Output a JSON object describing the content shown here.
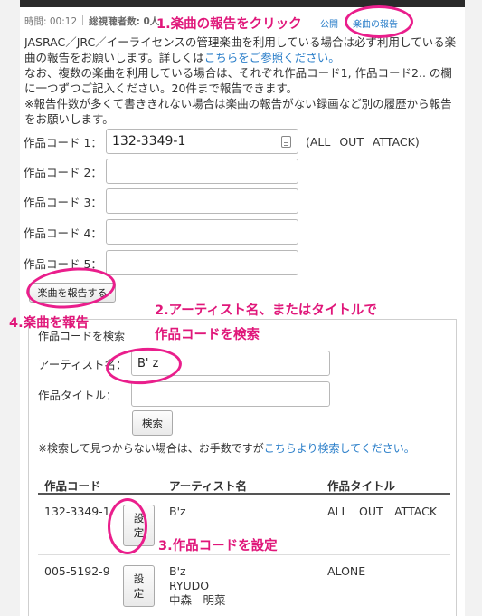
{
  "statusbar": {
    "time_label": "時間: 00:12",
    "viewers_label": "総視聴者数: 0人",
    "public_link": "公開",
    "report_link": "楽曲の報告"
  },
  "intro": {
    "line1": "JASRAC／JRC／イーライセンスの管理楽曲を利用している場合は必ず利用している楽曲の報告をお願いします。詳しくは",
    "line1_link": "こちらをご参照ください。",
    "line2": "なお、複数の楽曲を利用している場合は、それぞれ作品コード1, 作品コード2.. の欄に一つずつご記入ください。20件まで報告できます。",
    "line3": "※報告件数が多くて書ききれない場合は楽曲の報告がない録画など別の履歴から報告をお願いします。"
  },
  "codes": [
    {
      "label": "作品コード 1：",
      "value": "132-3349-1",
      "title": "(ALL OUT ATTACK)"
    },
    {
      "label": "作品コード 2：",
      "value": "",
      "title": ""
    },
    {
      "label": "作品コード 3：",
      "value": "",
      "title": ""
    },
    {
      "label": "作品コード 4：",
      "value": "",
      "title": ""
    },
    {
      "label": "作品コード 5：",
      "value": "",
      "title": ""
    }
  ],
  "report_button": "楽曲を報告する",
  "search": {
    "title": "作品コードを検索",
    "artist_label": "アーティスト名：",
    "artist_value": "B' z",
    "song_label": "作品タイトル：",
    "song_value": "",
    "button": "検索",
    "note_prefix": "※検索して見つからない場合は、お手数ですが",
    "note_link": "こちらより検索してください。"
  },
  "results": {
    "headers": [
      "作品コード",
      "アーティスト名",
      "作品タイトル"
    ],
    "set_button": "設定",
    "rows": [
      {
        "code": "132-3349-1",
        "artist": "B'z",
        "title": "ALL　OUT　ATTACK"
      },
      {
        "code": "005-5192-9",
        "artist": "B'z\nRYUDO\n中森　明菜",
        "title": "ALONE"
      }
    ]
  },
  "annotations": {
    "step1": "1.楽曲の報告をクリック",
    "step2_line1": "2.アーティスト名、またはタイトルで",
    "step2_line2": "作品コードを検索",
    "step3": "3.作品コードを設定",
    "step4": "4.楽曲を報告",
    "color": "#e0177a"
  }
}
